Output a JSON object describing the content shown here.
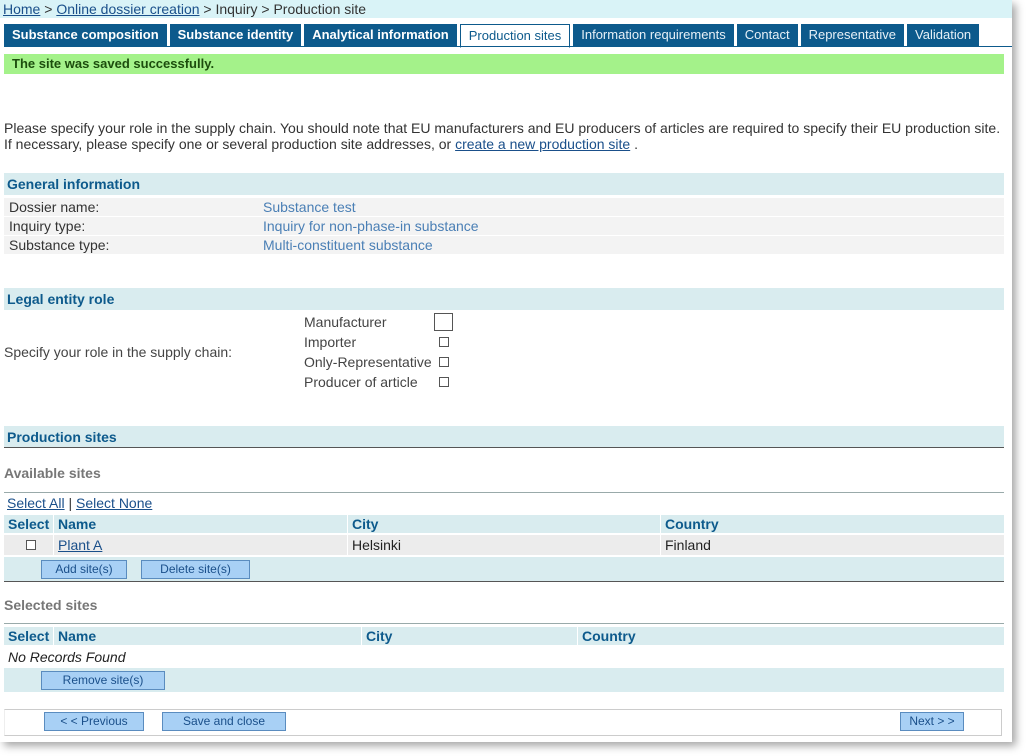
{
  "breadcrumb": {
    "home": "Home",
    "sep1": ">",
    "online": "Online dossier creation",
    "rest": "> Inquiry > Production site"
  },
  "tabs": [
    {
      "label": "Substance composition"
    },
    {
      "label": "Substance identity"
    },
    {
      "label": "Analytical information"
    },
    {
      "label": "Production sites"
    },
    {
      "label": "Information requirements"
    },
    {
      "label": "Contact"
    },
    {
      "label": "Representative"
    },
    {
      "label": "Validation"
    }
  ],
  "success_message": "The site was saved successfully.",
  "intro": {
    "text": "Please specify your role in the supply chain. You should note that EU manufacturers and EU producers of articles are required to specify their EU production site. If necessary, please specify one or several production site addresses, or",
    "link": "create a new production site",
    "end": "."
  },
  "general": {
    "heading": "General information",
    "rows": [
      {
        "label": "Dossier name:",
        "value": "Substance test"
      },
      {
        "label": "Inquiry type:",
        "value": "Inquiry for non-phase-in substance"
      },
      {
        "label": "Substance type:",
        "value": "Multi-constituent substance"
      }
    ]
  },
  "legal": {
    "heading": "Legal entity role",
    "prompt": "Specify your role in the supply chain:",
    "roles": [
      {
        "label": "Manufacturer",
        "checked": false
      },
      {
        "label": "Importer",
        "checked": false
      },
      {
        "label": "Only-Representative",
        "checked": false
      },
      {
        "label": "Producer of article",
        "checked": false
      }
    ]
  },
  "production": {
    "heading": "Production sites",
    "available": {
      "title": "Available sites",
      "select_all": "Select All",
      "sep": "|",
      "select_none": "Select None",
      "columns": [
        "Select",
        "Name",
        "City",
        "Country"
      ],
      "rows": [
        {
          "name": "Plant A",
          "city": "Helsinki",
          "country": "Finland"
        }
      ],
      "add_button": "Add site(s)",
      "delete_button": "Delete site(s)"
    },
    "selected": {
      "title": "Selected sites",
      "columns": [
        "Select",
        "Name",
        "City",
        "Country"
      ],
      "empty": "No Records Found",
      "remove_button": "Remove site(s)"
    }
  },
  "footer": {
    "previous": "< < Previous",
    "save_close": "Save and close",
    "next": "Next > >"
  }
}
